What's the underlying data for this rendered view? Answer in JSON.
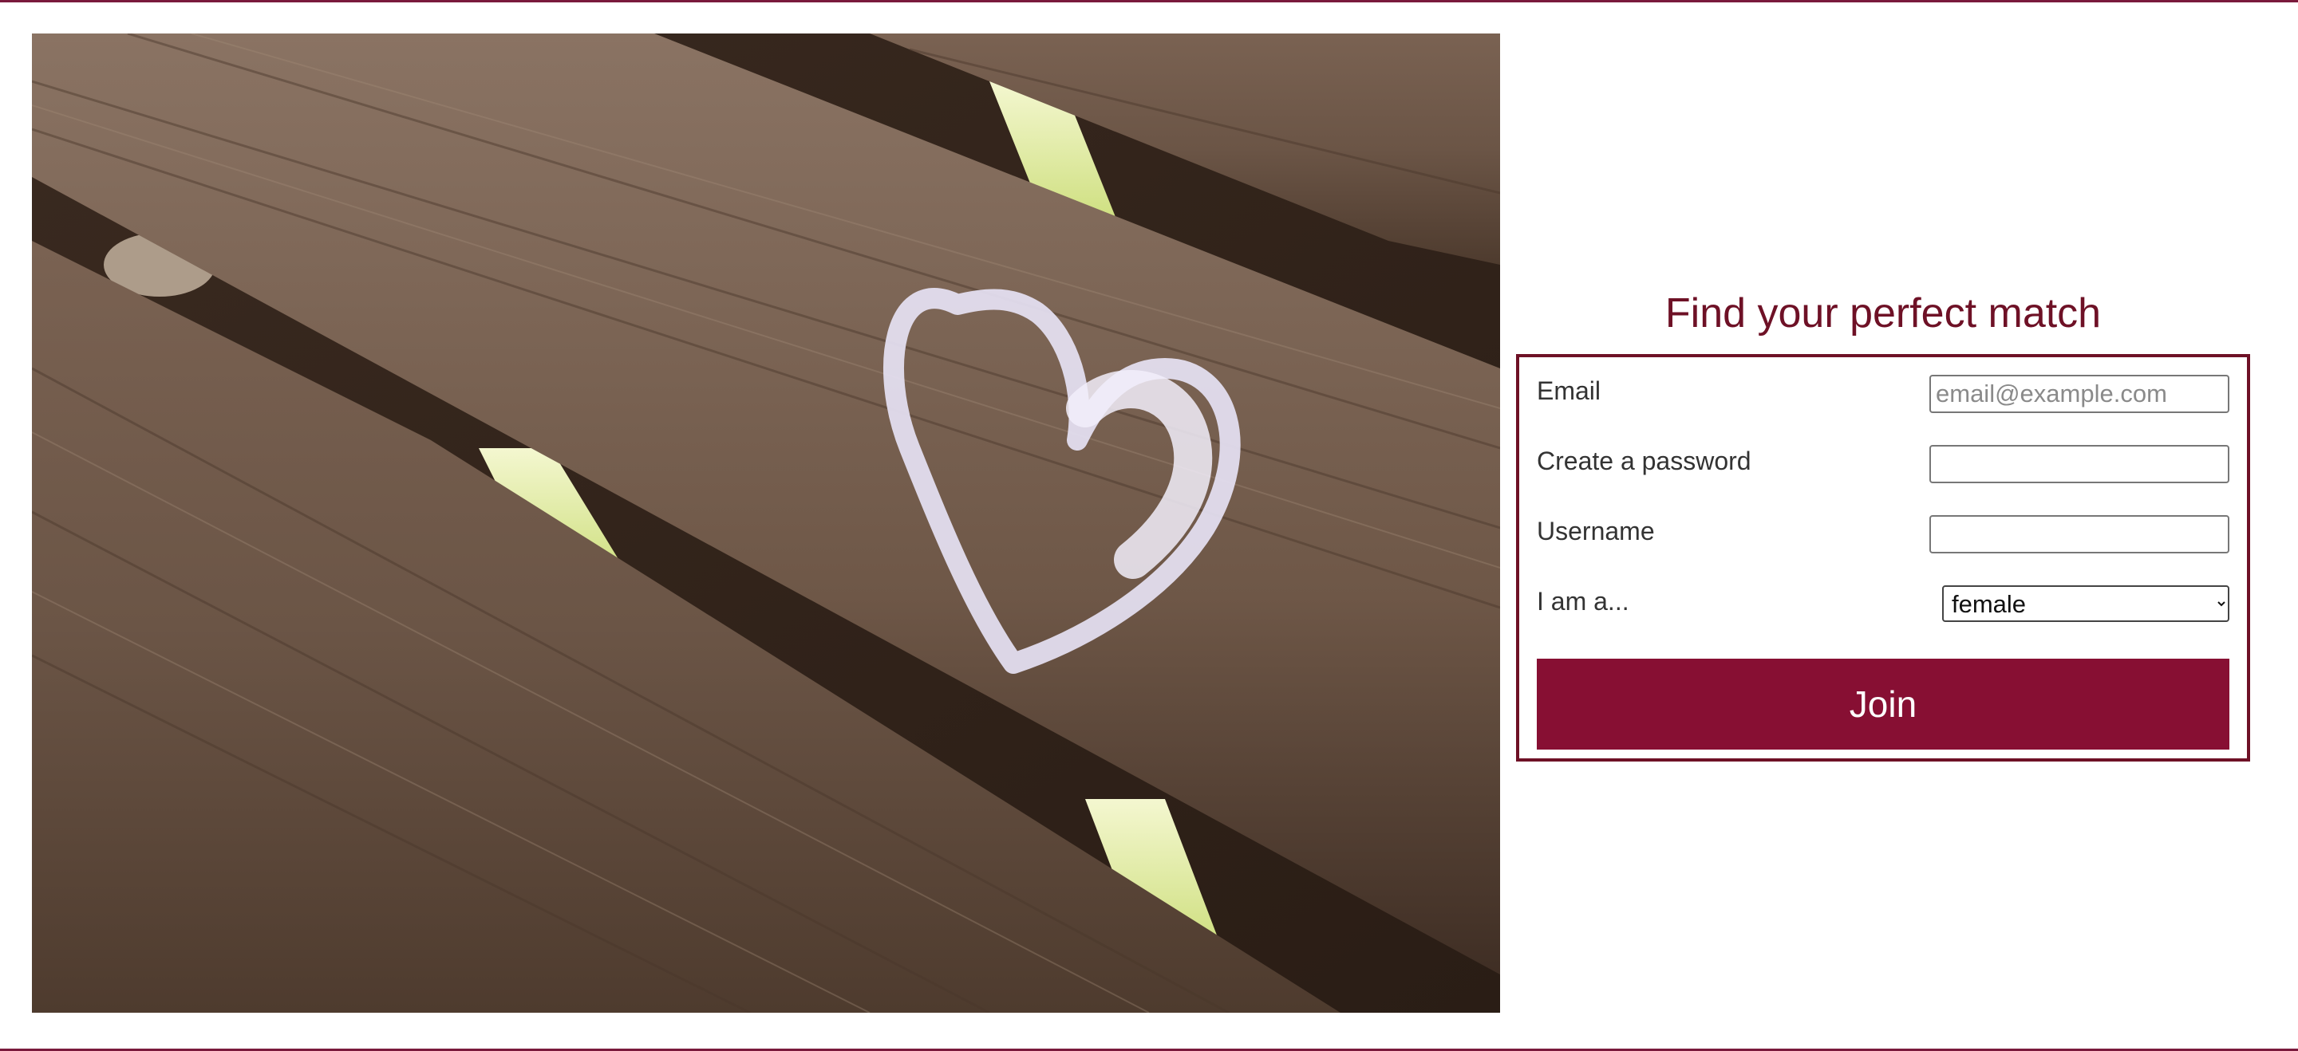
{
  "colors": {
    "brand": "#870f33",
    "title": "#6e1126",
    "border": "#6e1126",
    "rule": "#7a1a3c"
  },
  "hero": {
    "image": "wooden-bench-chalk-heart"
  },
  "signup": {
    "title": "Find your perfect match",
    "fields": {
      "email": {
        "label": "Email",
        "placeholder": "email@example.com",
        "value": ""
      },
      "password": {
        "label": "Create a password",
        "placeholder": "",
        "value": ""
      },
      "username": {
        "label": "Username",
        "placeholder": "",
        "value": ""
      },
      "gender": {
        "label": "I am a...",
        "selected": "female"
      }
    },
    "submit_label": "Join"
  }
}
